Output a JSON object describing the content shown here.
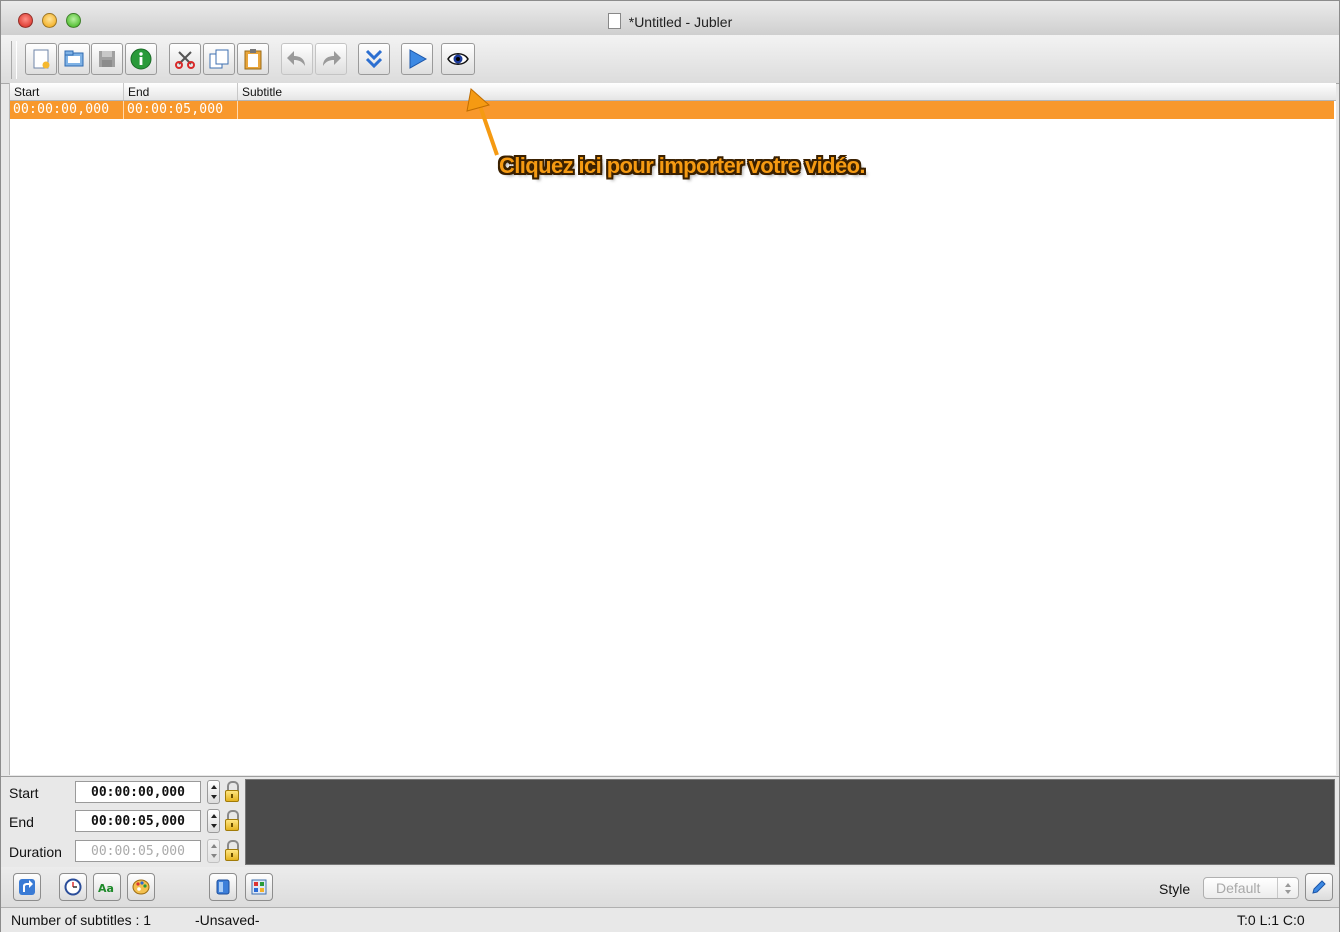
{
  "window": {
    "title": "*Untitled - Jubler"
  },
  "toolbar": {
    "buttons": [
      {
        "name": "new-button",
        "icon": "new-document-icon"
      },
      {
        "name": "open-button",
        "icon": "open-folder-icon"
      },
      {
        "name": "save-button",
        "icon": "save-disk-icon"
      },
      {
        "name": "info-button",
        "icon": "info-icon"
      },
      {
        "name": "cut-button",
        "icon": "scissors-icon"
      },
      {
        "name": "copy-button",
        "icon": "copy-icon"
      },
      {
        "name": "paste-button",
        "icon": "paste-icon"
      },
      {
        "name": "undo-button",
        "icon": "undo-icon"
      },
      {
        "name": "redo-button",
        "icon": "redo-icon"
      },
      {
        "name": "next-button",
        "icon": "double-chevron-down-icon"
      },
      {
        "name": "play-button",
        "icon": "play-icon"
      },
      {
        "name": "preview-button",
        "icon": "eye-icon"
      }
    ]
  },
  "table": {
    "columns": [
      "Start",
      "End",
      "Subtitle"
    ],
    "rows": [
      {
        "start": "00:00:00,000",
        "end": "00:00:05,000",
        "subtitle": ""
      }
    ]
  },
  "annotation": {
    "text": "Cliquez ici pour importer votre vidéo."
  },
  "editor": {
    "start_label": "Start",
    "start_value": "00:00:00,000",
    "end_label": "End",
    "end_value": "00:00:05,000",
    "duration_label": "Duration",
    "duration_value": "00:00:05,000"
  },
  "bottom": {
    "style_label": "Style",
    "style_value": "Default",
    "buttons": [
      "reload-icon",
      "clock-icon",
      "font-icon",
      "palette-icon",
      "database-icon",
      "color-grid-icon",
      "pencil-icon"
    ]
  },
  "status": {
    "count": "Number of subtitles : 1",
    "saved": "-Unsaved-",
    "position": "T:0 L:1 C:0"
  },
  "colors": {
    "selection": "#f8982c",
    "annotation": "#f59a12",
    "editor_bg": "#4b4b4b"
  }
}
